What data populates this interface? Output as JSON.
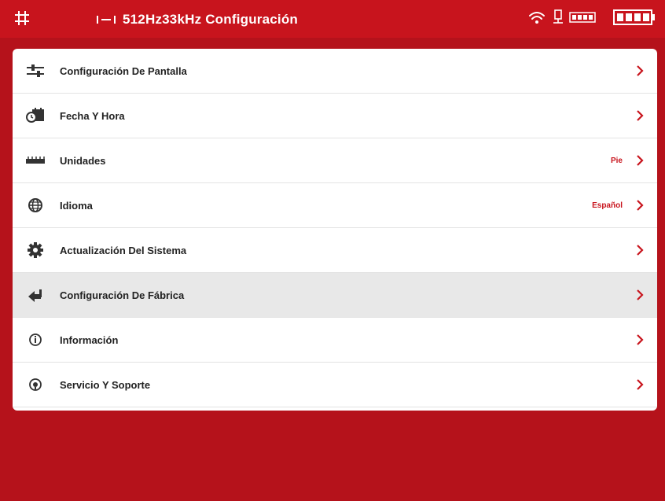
{
  "header": {
    "title": "512Hz33kHz Configuración"
  },
  "menu": [
    {
      "label": "Configuración De Pantalla",
      "value": "",
      "icon": "sliders-icon"
    },
    {
      "label": "Fecha Y Hora",
      "value": "",
      "icon": "calendar-clock-icon"
    },
    {
      "label": "Unidades",
      "value": "Pie",
      "icon": "ruler-icon"
    },
    {
      "label": "Idioma",
      "value": "Español",
      "icon": "globe-icon"
    },
    {
      "label": "Actualización Del Sistema",
      "value": "",
      "icon": "gear-icon"
    },
    {
      "label": "Configuración De Fábrica",
      "value": "",
      "icon": "reset-arrow-icon"
    },
    {
      "label": "Información",
      "value": "",
      "icon": "info-icon"
    },
    {
      "label": "Servicio Y Soporte",
      "value": "",
      "icon": "support-icon"
    }
  ],
  "colors": {
    "brand_red": "#c8141d",
    "background_red": "#b5121b",
    "value_text": "#c8141d",
    "highlight_row": "#e8e8e8"
  }
}
